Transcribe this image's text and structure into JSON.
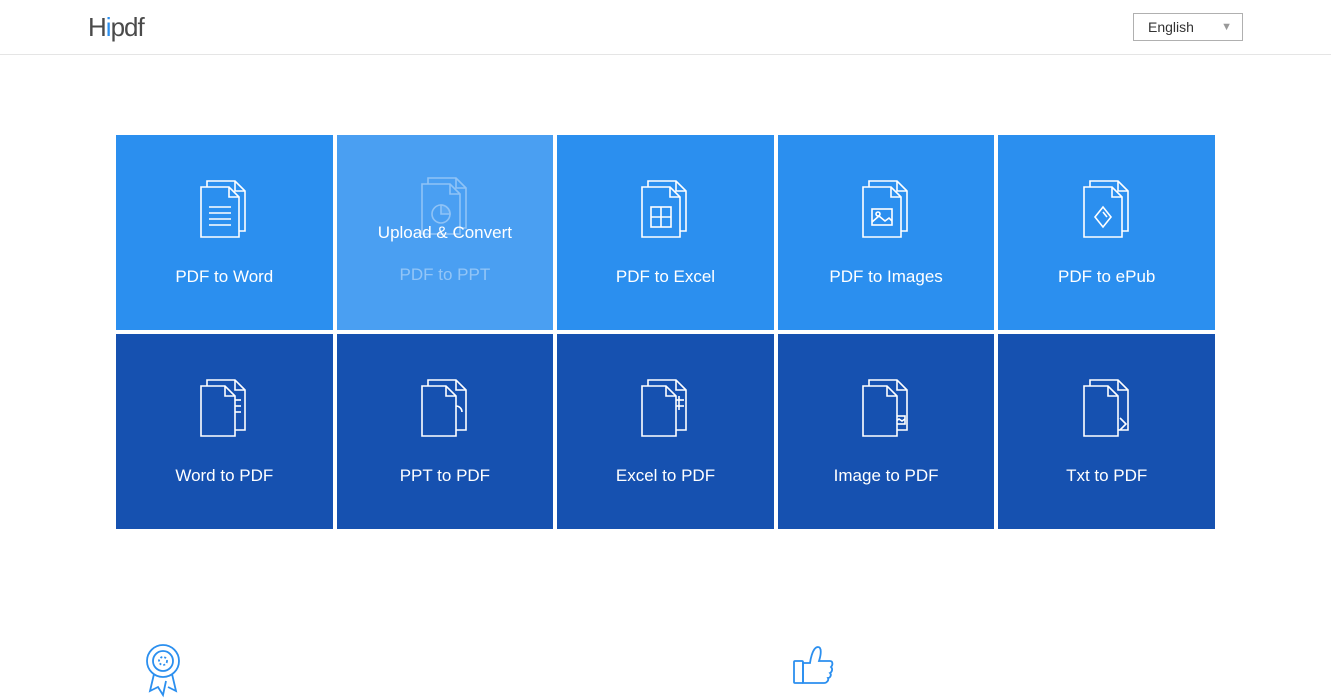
{
  "header": {
    "logo_text": "Hipdf",
    "language_label": "English"
  },
  "tiles_row1": [
    {
      "label": "PDF to Word",
      "icon": "doc-lines"
    },
    {
      "label": "PDF to PPT",
      "icon": "doc-pie",
      "hover_label": "Upload & Convert"
    },
    {
      "label": "PDF to Excel",
      "icon": "doc-grid"
    },
    {
      "label": "PDF to Images",
      "icon": "doc-image"
    },
    {
      "label": "PDF to ePub",
      "icon": "doc-diamond"
    }
  ],
  "tiles_row2": [
    {
      "label": "Word to PDF",
      "icon": "doc-lines-inv"
    },
    {
      "label": "PPT to PDF",
      "icon": "doc-pie-inv"
    },
    {
      "label": "Excel to PDF",
      "icon": "doc-grid-inv"
    },
    {
      "label": "Image to PDF",
      "icon": "doc-image-inv"
    },
    {
      "label": "Txt to PDF",
      "icon": "doc-fold-inv"
    }
  ],
  "features": [
    {
      "icon": "award"
    },
    {
      "icon": "thumbs-up"
    }
  ]
}
